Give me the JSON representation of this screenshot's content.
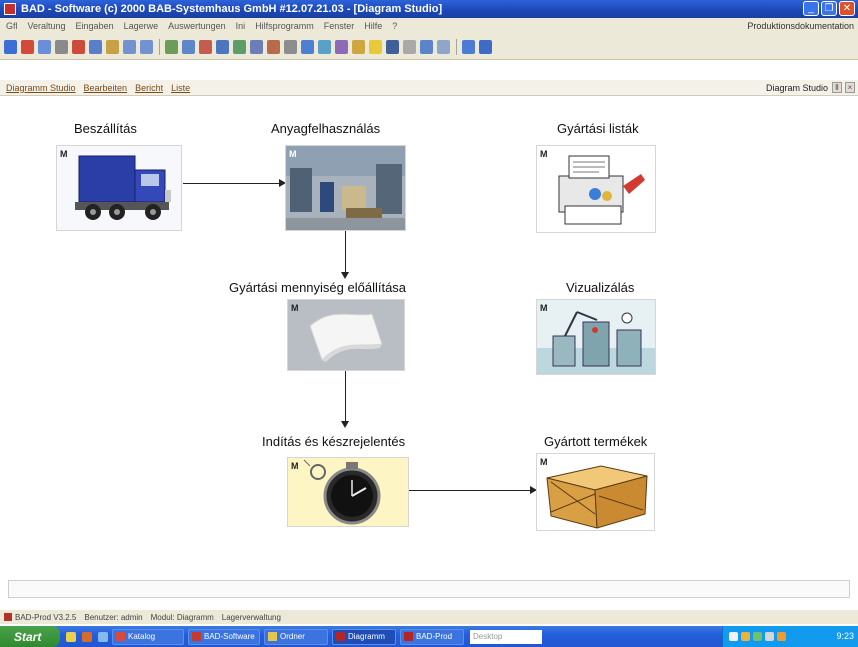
{
  "window": {
    "title": "BAD - Software   (c) 2000 BAB-Systemhaus GmbH #12.07.21.03 - [Diagram Studio]",
    "buttons": [
      "_",
      "❐",
      "✕"
    ]
  },
  "menubar": {
    "items": [
      "Gfl",
      "Veraltung",
      "Eingaben",
      "Lagerwe",
      "Auswertungen",
      "Ini",
      "Hilfsprogramm",
      "Fenster",
      "Hilfe",
      "?"
    ],
    "right_label": "Produktionsdokumentation"
  },
  "subheader": {
    "links": [
      "Diagramm Studio",
      "Bearbeiten",
      "Bericht",
      "Liste"
    ],
    "right_label": "Diagram Studio",
    "pin": "Ⅱ",
    "close": "×"
  },
  "diagram": {
    "nodes": [
      {
        "id": "beszallitas",
        "label": "Beszállítás",
        "icon": "truck-icon",
        "mark": "M"
      },
      {
        "id": "anyagfelhasznalas",
        "label": "Anyagfelhasználás",
        "icon": "warehouse-icon",
        "mark": "M"
      },
      {
        "id": "gyartasi-listak",
        "label": "Gyártási listák",
        "icon": "printer-icon",
        "mark": "M"
      },
      {
        "id": "gyartasi-mennyiseg",
        "label": "Gyártási mennyiség előállítása",
        "icon": "paper-sheet-icon",
        "mark": "M"
      },
      {
        "id": "vizualizalas",
        "label": "Vizualizálás",
        "icon": "factory-machine-icon",
        "mark": "M"
      },
      {
        "id": "inditas",
        "label": "Indítás és készrejelentés",
        "icon": "stopwatch-icon",
        "mark": "M"
      },
      {
        "id": "gyartott-termekek",
        "label": "Gyártott termékek",
        "icon": "cardboard-box-icon",
        "mark": "M"
      }
    ]
  },
  "statusbar": {
    "segments": [
      "BAD-Prod V3.2.5",
      "Benutzer: admin",
      "Modul: Diagramm",
      "Lagerverwaltung"
    ]
  },
  "taskbar": {
    "start_label": "Start",
    "tasks": [
      "Katalog",
      "BAD-Software",
      "Ordner",
      "Diagramm",
      "BAD-Prod"
    ],
    "search_placeholder": "Desktop",
    "clock": "9:23"
  },
  "colors": {
    "title_blue": "#1b47b8",
    "chrome": "#ece9d8",
    "taskbar_blue": "#245edb",
    "start_green": "#3a913a",
    "tray_blue": "#119aee"
  }
}
